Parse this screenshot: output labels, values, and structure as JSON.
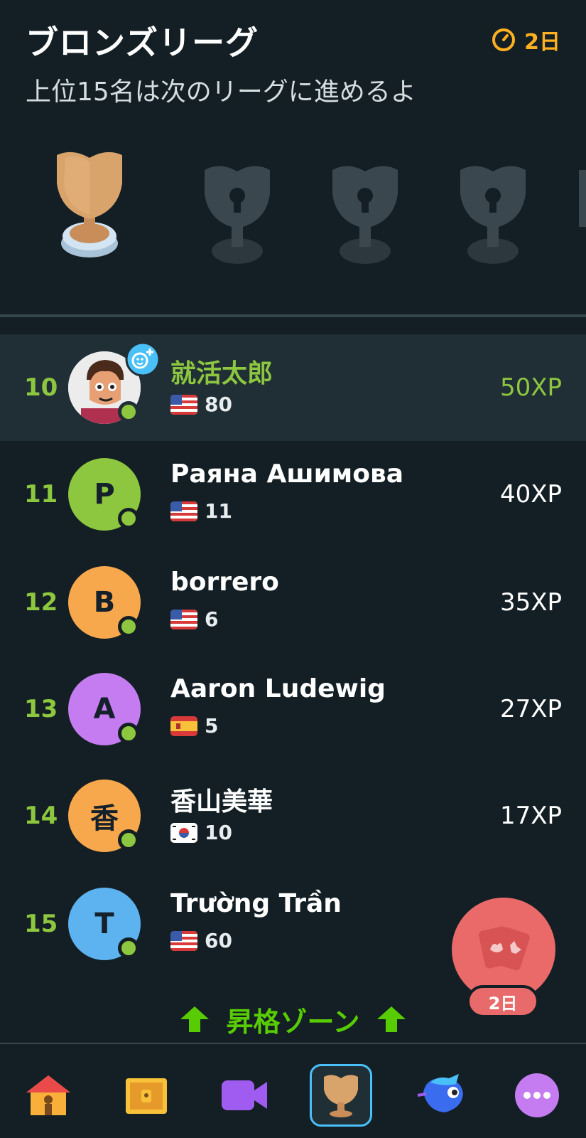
{
  "header": {
    "title": "ブロンズリーグ",
    "timer": "2日",
    "subtitle": "上位15名は次のリーグに進めるよ"
  },
  "leaderboard": [
    {
      "rank": "10",
      "name": "就活太郎",
      "flag": "us",
      "count": "80",
      "xp": "50XP",
      "avatar_letter": "",
      "avatar_color": "#e8e8e8",
      "current": true
    },
    {
      "rank": "11",
      "name": "Раяна Ашимова",
      "flag": "us",
      "count": "11",
      "xp": "40XP",
      "avatar_letter": "Р",
      "avatar_color": "#8dc63f",
      "current": false
    },
    {
      "rank": "12",
      "name": "borrero",
      "flag": "us",
      "count": "6",
      "xp": "35XP",
      "avatar_letter": "B",
      "avatar_color": "#f8a84c",
      "current": false
    },
    {
      "rank": "13",
      "name": "Aaron Ludewig",
      "flag": "es",
      "count": "5",
      "xp": "27XP",
      "avatar_letter": "A",
      "avatar_color": "#c47cf0",
      "current": false
    },
    {
      "rank": "14",
      "name": "香山美華",
      "flag": "kr",
      "count": "10",
      "xp": "17XP",
      "avatar_letter": "香",
      "avatar_color": "#f8a84c",
      "current": false
    },
    {
      "rank": "15",
      "name": "Trường Trần",
      "flag": "us",
      "count": "60",
      "xp": "",
      "avatar_letter": "T",
      "avatar_color": "#5db3f0",
      "current": false
    }
  ],
  "promotion_zone": "昇格ゾーン",
  "fab": {
    "badge": "2日"
  },
  "colors": {
    "accent_green": "#8dc63f",
    "bronze": "#c98d5a",
    "timer": "#ffb020",
    "background": "#131f24"
  },
  "nav": [
    "home-icon",
    "treasure-chest-icon",
    "video-icon",
    "trophy-icon",
    "character-icon",
    "more-icon"
  ]
}
